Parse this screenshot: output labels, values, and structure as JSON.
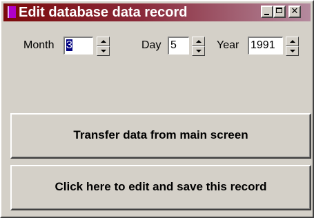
{
  "window": {
    "title": "Edit database data record",
    "minimize_icon": "minimize-icon",
    "maximize_icon": "maximize-icon",
    "close_icon": "close-icon",
    "close_glyph": "✕"
  },
  "date": {
    "month": {
      "label": "Month",
      "value": "3"
    },
    "day": {
      "label": "Day",
      "value": "5"
    },
    "year": {
      "label": "Year",
      "value": "1991"
    }
  },
  "buttons": {
    "transfer_label": "Transfer data from main screen",
    "edit_label": "Click here to edit and save this record"
  },
  "colors": {
    "titlebar_start": "#7b0a0a",
    "titlebar_end": "#b48a9e",
    "face": "#d4d0c8"
  }
}
